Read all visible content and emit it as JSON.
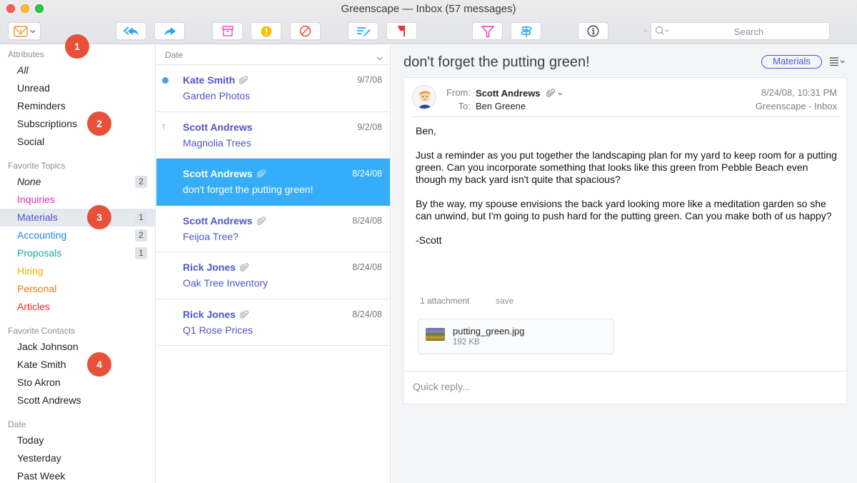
{
  "window": {
    "title": "Greenscape — Inbox (57 messages)"
  },
  "toolbar": {
    "buttons": [
      {
        "name": "get-mail",
        "icon": "inbox-tray-icon",
        "color": "#f6943c"
      },
      {
        "name": "reply-all",
        "icon": "reply-all-icon",
        "color": "#2aa5f3"
      },
      {
        "name": "forward",
        "icon": "forward-icon",
        "color": "#2aa5f3"
      },
      {
        "name": "archive",
        "icon": "archive-box-icon",
        "color": "#e63bbd"
      },
      {
        "name": "junk",
        "icon": "alert-icon",
        "color": "#f5c100"
      },
      {
        "name": "block",
        "icon": "block-icon",
        "color": "#f0483a"
      },
      {
        "name": "compose",
        "icon": "compose-icon",
        "color": "#2aa5f3"
      },
      {
        "name": "flag",
        "icon": "flag-icon",
        "color": "#f0303a"
      },
      {
        "name": "filter",
        "icon": "filter-icon",
        "color": "#e63bbd"
      },
      {
        "name": "rules",
        "icon": "signpost-icon",
        "color": "#2aa5f3"
      },
      {
        "name": "info",
        "icon": "info-icon",
        "color": "#333333"
      }
    ],
    "search_placeholder": "Search"
  },
  "sidebar": {
    "sections": [
      {
        "title": "Attributes",
        "items": [
          {
            "label": "All",
            "italic": true
          },
          {
            "label": "Unread"
          },
          {
            "label": "Reminders"
          },
          {
            "label": "Subscriptions"
          },
          {
            "label": "Social"
          }
        ]
      },
      {
        "title": "Favorite Topics",
        "items": [
          {
            "label": "None",
            "italic": true,
            "count": "2",
            "color": "#222222"
          },
          {
            "label": "Inquiries",
            "color": "#e02fb0"
          },
          {
            "label": "Materials",
            "count": "1",
            "color": "#5055c9",
            "selected": true
          },
          {
            "label": "Accounting",
            "count": "2",
            "color": "#1f86dd"
          },
          {
            "label": "Proposals",
            "count": "1",
            "color": "#16ad94"
          },
          {
            "label": "Hiring",
            "color": "#e4b500"
          },
          {
            "label": "Personal",
            "color": "#ee7a12"
          },
          {
            "label": "Articles",
            "color": "#ee2a2a"
          }
        ]
      },
      {
        "title": "Favorite Contacts",
        "items": [
          {
            "label": "Jack Johnson"
          },
          {
            "label": "Kate Smith"
          },
          {
            "label": "Sto Akron"
          },
          {
            "label": "Scott Andrews"
          }
        ]
      },
      {
        "title": "Date",
        "items": [
          {
            "label": "Today"
          },
          {
            "label": "Yesterday"
          },
          {
            "label": "Past Week"
          }
        ]
      }
    ]
  },
  "message_list": {
    "sort_label": "Date",
    "messages": [
      {
        "from": "Kate Smith",
        "subject": "Garden Photos",
        "date": "9/7/08",
        "unread": true,
        "attachment": true
      },
      {
        "from": "Scott Andrews",
        "subject": "Magnolia Trees",
        "date": "9/2/08",
        "replied": true,
        "attachment": false
      },
      {
        "from": "Scott Andrews",
        "subject": "don't forget the putting green!",
        "date": "8/24/08",
        "attachment": true,
        "selected": true
      },
      {
        "from": "Scott Andrews",
        "subject": "Feijoa Tree?",
        "date": "8/24/08",
        "attachment": true
      },
      {
        "from": "Rick Jones",
        "subject": "Oak Tree Inventory",
        "date": "8/24/08",
        "attachment": true
      },
      {
        "from": "Rick Jones",
        "subject": "Q1 Rose Prices",
        "date": "8/24/08",
        "attachment": true
      }
    ]
  },
  "reader": {
    "subject": "don't forget the putting green!",
    "topic_tag": "Materials",
    "from_label": "From:",
    "from": "Scott Andrews",
    "to_label": "To:",
    "to": "Ben Greene",
    "datetime": "8/24/08, 10:31 PM",
    "mailbox": "Greenscape - Inbox",
    "body": [
      "Ben,",
      "Just a reminder as you put together the landscaping plan for my yard to keep room for a putting green. Can you incorporate something that looks like this green from Pebble Beach even though my back yard isn't quite that spacious?",
      "By the way, my spouse envisions the back yard looking more like a meditation garden so she can unwind, but I'm going to push hard for the putting green. Can you make both of us happy?",
      "-Scott"
    ],
    "attachments_label": "1 attachment",
    "save_label": "save",
    "attachment": {
      "name": "putting_green.jpg",
      "size": "192 KB"
    },
    "quick_reply_placeholder": "Quick reply..."
  },
  "annotations": [
    "1",
    "2",
    "3",
    "4"
  ]
}
